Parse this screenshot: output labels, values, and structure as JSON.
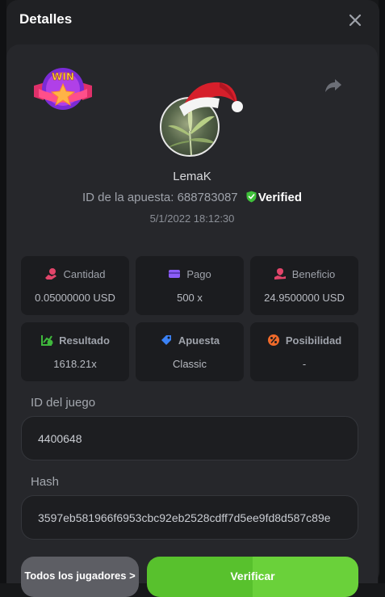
{
  "dialog": {
    "title": "Detalles"
  },
  "bet": {
    "username": "LemaK",
    "bet_id_label": "ID de la apuesta:",
    "bet_id": "688783087",
    "verified_label": "Verified",
    "date": "5/1/2022 18:12:30",
    "win_badge_text": "WIN"
  },
  "stats": {
    "cantidad": {
      "label": "Cantidad",
      "value": "0.05000000 USD",
      "icon": "coin-hand-icon"
    },
    "pago": {
      "label": "Pago",
      "value": "500 x",
      "icon": "card-icon"
    },
    "beneficio": {
      "label": "Beneficio",
      "value": "24.9500000 USD",
      "icon": "profit-hand-icon"
    },
    "resultado": {
      "label": "Resultado",
      "value": "1618.21x",
      "icon": "chart-check-icon"
    },
    "apuesta": {
      "label": "Apuesta",
      "value": "Classic",
      "icon": "ticket-icon"
    },
    "posibilidad": {
      "label": "Posibilidad",
      "value": "-",
      "icon": "percent-icon"
    }
  },
  "fields": {
    "game_id_label": "ID del juego",
    "game_id": "4400648",
    "hash_label": "Hash",
    "hash": "3597eb581966f6953cbc92eb2528cdff7d5ee9fd8d587c89e"
  },
  "buttons": {
    "all_players": "Todos los jugadores >",
    "verify": "Verificar"
  },
  "colors": {
    "accent_green": "#58c12d",
    "verified_green": "#3fc03a",
    "cantidad_icon": "#e2456a",
    "pago_icon": "#8b5cf6",
    "beneficio_icon": "#e2456a",
    "resultado_icon": "#3fb83c",
    "apuesta_icon": "#3b82f6",
    "posibilidad_icon": "#f06a2a"
  }
}
